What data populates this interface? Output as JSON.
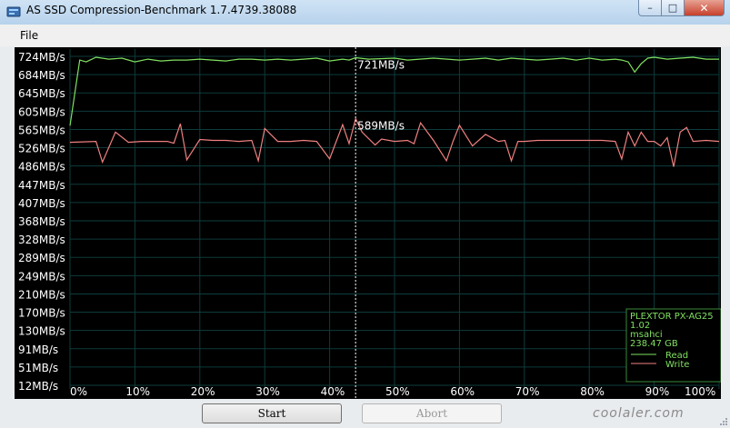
{
  "window": {
    "title": "AS SSD Compression-Benchmark 1.7.4739.38088",
    "controls": {
      "minimize": "–",
      "maximize": "□",
      "close": "✕"
    }
  },
  "menu": {
    "file": "File"
  },
  "buttons": {
    "start": "Start",
    "abort": "Abort"
  },
  "watermark": "coolaler.com",
  "info_box": {
    "device": "PLEXTOR PX-AG25",
    "firmware": "1.02",
    "driver": "msahci",
    "capacity": "238.47 GB",
    "legend_read": "Read",
    "legend_write": "Write"
  },
  "colors": {
    "read": "#7fe060",
    "write": "#f08080",
    "grid": "#0e3b3b",
    "text": "#ffffff"
  },
  "chart_data": {
    "type": "line",
    "y_tick_labels": [
      "724MB/s",
      "684MB/s",
      "645MB/s",
      "605MB/s",
      "565MB/s",
      "526MB/s",
      "486MB/s",
      "447MB/s",
      "407MB/s",
      "368MB/s",
      "328MB/s",
      "289MB/s",
      "249MB/s",
      "210MB/s",
      "170MB/s",
      "130MB/s",
      "91MB/s",
      "51MB/s",
      "12MB/s"
    ],
    "x_tick_labels": [
      "0%",
      "10%",
      "20%",
      "30%",
      "40%",
      "50%",
      "60%",
      "70%",
      "80%",
      "90%",
      "100%"
    ],
    "ylim": [
      12,
      724
    ],
    "xlim": [
      0,
      100
    ],
    "grid": true,
    "legend": "bottom-right",
    "marker": {
      "x": 44,
      "read_label": "721MB/s",
      "write_label": "589MB/s"
    },
    "series": [
      {
        "name": "Read",
        "color": "#7fe060",
        "x": [
          0,
          1.5,
          2.5,
          4,
          6,
          8,
          10,
          12,
          14,
          16,
          18,
          20,
          22,
          24,
          26,
          28,
          30,
          32,
          34,
          36,
          38,
          40,
          42,
          43,
          44,
          46,
          50,
          52,
          56,
          60,
          62,
          64,
          66,
          68,
          70,
          72,
          74,
          76,
          78,
          80,
          82,
          84,
          85,
          86,
          87,
          88,
          89,
          90,
          92,
          94,
          96,
          98,
          100
        ],
        "y": [
          574,
          716,
          712,
          722,
          718,
          720,
          712,
          718,
          714,
          716,
          716,
          718,
          716,
          714,
          718,
          718,
          716,
          718,
          716,
          718,
          720,
          714,
          718,
          716,
          721,
          718,
          720,
          716,
          720,
          716,
          718,
          720,
          716,
          720,
          718,
          716,
          718,
          720,
          716,
          720,
          716,
          718,
          716,
          712,
          690,
          708,
          720,
          722,
          718,
          720,
          722,
          718,
          718
        ]
      },
      {
        "name": "Write",
        "color": "#f08080",
        "x": [
          0,
          4,
          5,
          7,
          9,
          11,
          13,
          15,
          16,
          17,
          18,
          20,
          22,
          24,
          26,
          28,
          29,
          30,
          32,
          34,
          36,
          38,
          40,
          42,
          43,
          44,
          45,
          47,
          48,
          50,
          52,
          53,
          54,
          56,
          58,
          59,
          60,
          62,
          64,
          66,
          67,
          68,
          69,
          70,
          72,
          74,
          76,
          78,
          80,
          82,
          84,
          85,
          86,
          87,
          88,
          89,
          90,
          91,
          92,
          93,
          94,
          95,
          96,
          98,
          100
        ],
        "y": [
          538,
          540,
          495,
          560,
          538,
          540,
          540,
          540,
          536,
          578,
          500,
          544,
          542,
          542,
          540,
          542,
          498,
          568,
          540,
          540,
          542,
          540,
          502,
          576,
          535,
          589,
          560,
          532,
          545,
          540,
          542,
          535,
          580,
          542,
          498,
          540,
          575,
          530,
          555,
          540,
          542,
          498,
          540,
          540,
          542,
          542,
          542,
          542,
          542,
          542,
          540,
          502,
          560,
          530,
          560,
          540,
          540,
          530,
          548,
          485,
          560,
          570,
          540,
          542,
          540
        ]
      }
    ]
  }
}
